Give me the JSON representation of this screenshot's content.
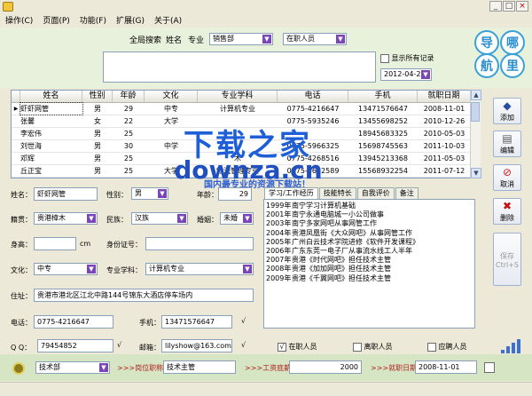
{
  "menu": [
    "操作(C)",
    "页面(P)",
    "功能(F)",
    "扩展(G)",
    "关于(A)"
  ],
  "search": {
    "tab_label": "全局搜索",
    "name_label": "姓名",
    "major_label": "专业",
    "dept_value": "销售部",
    "status_value": "在职人员",
    "show_all_label": "显示所有记录",
    "date_value": "2012-04-23"
  },
  "logo": {
    "chars": [
      "导",
      "哪",
      "航",
      "里"
    ]
  },
  "grid": {
    "headers": [
      "姓名",
      "性别",
      "年龄",
      "文化",
      "专业学科",
      "电话",
      "手机",
      "就职日期"
    ],
    "rows": [
      [
        "虾虾网管",
        "男",
        "29",
        "中专",
        "计算机专业",
        "0775-4216647",
        "13471576647",
        "2008-11-01"
      ],
      [
        "张馨",
        "女",
        "22",
        "大学",
        "",
        "0775-5935246",
        "13455698252",
        "2010-12-26"
      ],
      [
        "李宏伟",
        "男",
        "25",
        "",
        "",
        "",
        "18945683325",
        "2010-05-03"
      ],
      [
        "刘世海",
        "男",
        "30",
        "中学",
        "",
        "0775-5966325",
        "15698745563",
        "2011-10-03"
      ],
      [
        "邓辉",
        "男",
        "25",
        "",
        "木",
        "0775-4268516",
        "13945213368",
        "2011-05-03"
      ],
      [
        "丘正宝",
        "男",
        "25",
        "大学",
        "物流管理专业",
        "0775-4632589",
        "15568932254",
        "2011-07-12"
      ]
    ]
  },
  "watermark": {
    "line1": "下载之家",
    "line2": "downza.cn",
    "line3": "国内最专业的资源下载站！"
  },
  "side": {
    "add": "添加",
    "edit": "编辑",
    "cancel": "取消",
    "delete": "删除",
    "save": "保存",
    "save_key": "Ctrl+S"
  },
  "form": {
    "name_label": "姓名：",
    "name": "虾虾网管",
    "gender_label": "性别：",
    "gender": "男",
    "age_label": "年龄：",
    "age": "29",
    "native_label": "籍贯：",
    "native": "贵港樟木",
    "ethnic_label": "民族：",
    "ethnic": "汉族",
    "marital_label": "婚姻：",
    "marital": "未婚",
    "height_label": "身高：",
    "height_unit": "cm",
    "id_label": "身份证号：",
    "edu_label": "文化：",
    "edu": "中专",
    "major_label": "专业学科：",
    "major": "计算机专业",
    "addr_label": "住址：",
    "addr": "贵港市港北区江北中路144号锦东大酒店停车场内",
    "phone_label": "电话：",
    "phone": "0775-4216647",
    "mobile_label": "手机：",
    "mobile": "13471576647",
    "qq_label": "Q Q：",
    "qq": "79454852",
    "email_label": "邮箱：",
    "email": "lilyshow@163.com",
    "check": "√"
  },
  "tabs": [
    "学习/工作经历",
    "技能特长",
    "自我评价",
    "备注"
  ],
  "experience": [
    [
      "1999年",
      "南宁学习计算机基础"
    ],
    [
      "2001年",
      "南宁永通电脑城一小公司做事"
    ],
    [
      "2003年",
      "南宁多家网吧从事网管工作"
    ],
    [
      "2004年",
      "贵港凤凰街《大众网吧》从事网管工作"
    ],
    [
      "2005年",
      "广州白云技术学院进修《软件开发课程》"
    ],
    [
      "2006年",
      "广东东莞一电子厂从事流水线工人半年"
    ],
    [
      "2007年",
      "贵港《时代网吧》担任技术主管"
    ],
    [
      "2008年",
      "贵港《加加网吧》担任技术主管"
    ],
    [
      "2009年",
      "贵港《千翼网吧》担任技术主管"
    ]
  ],
  "status": {
    "active": "在职人员",
    "left": "离职人员",
    "applicant": "应聘人员"
  },
  "bottom": {
    "dept": "技术部",
    "post_label": ">>>岗位职称",
    "post": "技术主管",
    "salary_label": ">>>工资底薪",
    "salary": "2000",
    "date_label": ">>>就职日期",
    "date": "2008-11-01"
  },
  "colors": {
    "accent": "#7a45b4",
    "band": "#e8f1dc",
    "bottom": "#d6e6c4"
  }
}
